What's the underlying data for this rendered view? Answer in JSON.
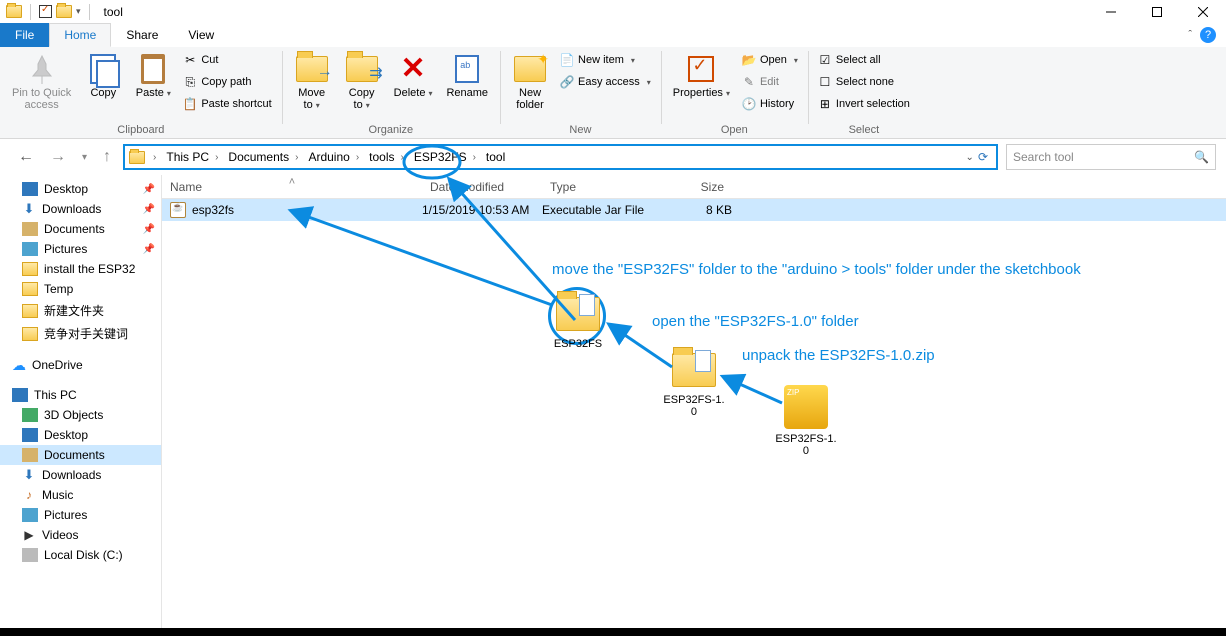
{
  "window": {
    "title": "tool"
  },
  "tabs": {
    "file": "File",
    "home": "Home",
    "share": "Share",
    "view": "View"
  },
  "ribbon": {
    "clipboard": {
      "label": "Clipboard",
      "pin": "Pin to Quick\naccess",
      "copy": "Copy",
      "paste": "Paste",
      "cut": "Cut",
      "copypath": "Copy path",
      "pasteshortcut": "Paste shortcut"
    },
    "organize": {
      "label": "Organize",
      "moveto": "Move\nto",
      "copyto": "Copy\nto",
      "delete": "Delete",
      "rename": "Rename"
    },
    "new": {
      "label": "New",
      "newfolder": "New\nfolder",
      "newitem": "New item",
      "easyaccess": "Easy access"
    },
    "open": {
      "label": "Open",
      "properties": "Properties",
      "open": "Open",
      "edit": "Edit",
      "history": "History"
    },
    "select": {
      "label": "Select",
      "selectall": "Select all",
      "selectnone": "Select none",
      "invert": "Invert selection"
    }
  },
  "breadcrumb": {
    "items": [
      "This PC",
      "Documents",
      "Arduino",
      "tools",
      "ESP32FS",
      "tool"
    ]
  },
  "search": {
    "placeholder": "Search tool"
  },
  "nav": {
    "quick": {
      "desktop": "Desktop",
      "downloads": "Downloads",
      "documents": "Documents",
      "pictures": "Pictures",
      "install": "install the ESP32",
      "temp": "Temp",
      "cn1": "新建文件夹",
      "cn2": "竞争对手关键词"
    },
    "onedrive": "OneDrive",
    "thispc": "This PC",
    "pc": {
      "obj3d": "3D Objects",
      "desktop": "Desktop",
      "documents": "Documents",
      "downloads": "Downloads",
      "music": "Music",
      "pictures": "Pictures",
      "videos": "Videos",
      "localdisk": "Local Disk (C:)"
    }
  },
  "columns": {
    "name": "Name",
    "date": "Date modified",
    "type": "Type",
    "size": "Size"
  },
  "files": [
    {
      "name": "esp32fs",
      "date": "1/15/2019 10:53 AM",
      "type": "Executable Jar File",
      "size": "8 KB"
    }
  ],
  "annotations": {
    "move": "move the \"ESP32FS\" folder to the \"arduino > tools\" folder under the sketchbook",
    "open": "open the \"ESP32FS-1.0\" folder",
    "unpack": "unpack the ESP32FS-1.0.zip",
    "folder1": "ESP32FS",
    "folder2": "ESP32FS-1.\n0",
    "zip": "ESP32FS-1.\n0"
  }
}
